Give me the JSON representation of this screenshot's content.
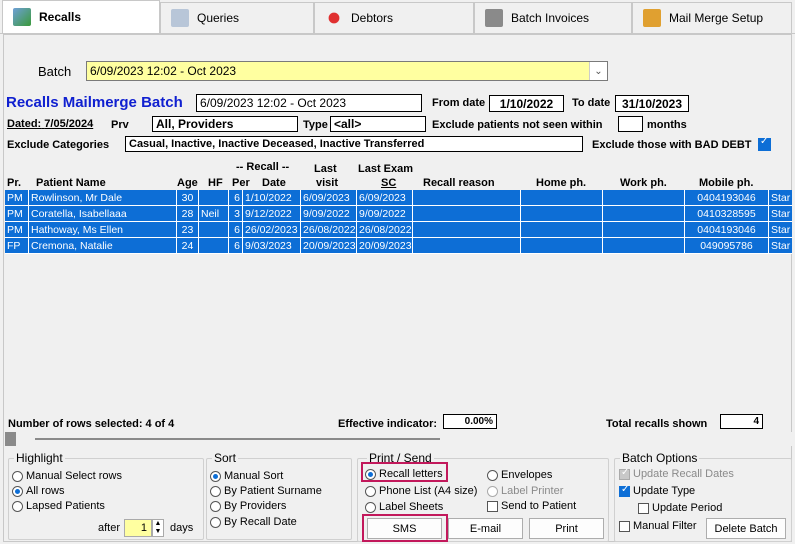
{
  "tabs": [
    {
      "label": "Recalls",
      "icon": "recalls-icon"
    },
    {
      "label": "Queries",
      "icon": "queries-icon"
    },
    {
      "label": "Debtors",
      "icon": "debtors-icon"
    },
    {
      "label": "Batch Invoices",
      "icon": "printer-icon"
    },
    {
      "label": "Mail Merge Setup",
      "icon": "mail-merge-icon"
    }
  ],
  "batch": {
    "label": "Batch",
    "value": "6/09/2023 12:02 - Oct 2023"
  },
  "header": {
    "title": "Recalls Mailmerge Batch",
    "batch_name": "6/09/2023 12:02 - Oct 2023",
    "from_label": "From date",
    "from_value": "1/10/2022",
    "to_label": "To date",
    "to_value": "31/10/2023",
    "dated_label": "Dated:",
    "dated_value": "7/05/2024",
    "prv_label": "Prv",
    "prv_value": "All,   Providers",
    "type_label": "Type",
    "type_value": "<all>",
    "exclude_not_seen_label": "Exclude patients not seen within",
    "exclude_not_seen_value": "",
    "months_label": "months",
    "exclude_categories_label": "Exclude Categories",
    "exclude_categories_value": "Casual, Inactive, Inactive Deceased, Inactive Transferred",
    "bad_debt_label": "Exclude those with BAD DEBT"
  },
  "columns": {
    "pr": "Pr.",
    "name": "Patient Name",
    "age": "Age",
    "hf": "HF",
    "recall_group": "-- Recall --",
    "per": "Per",
    "date": "Date",
    "last_visit_1": "Last",
    "last_visit_2": "visit",
    "last_exam_1": "Last Exam",
    "last_exam_2": "SC",
    "reason": "Recall reason",
    "home": "Home ph.",
    "work": "Work ph.",
    "mobile": "Mobile ph."
  },
  "rows": [
    {
      "pr": "PM",
      "name": "Rowlinson, Mr Dale",
      "age": "30",
      "hf": "",
      "per": "6",
      "date": "1/10/2022",
      "visit": "6/09/2023",
      "exam": "6/09/2023",
      "reason": "",
      "home": "",
      "work": "",
      "mobile": "0404193046",
      "extra": "Star"
    },
    {
      "pr": "PM",
      "name": "Coratella, Isabellaaa",
      "age": "28",
      "hf": "Neil",
      "per": "3",
      "date": "9/12/2022",
      "visit": "9/09/2022",
      "exam": "9/09/2022",
      "reason": "",
      "home": "",
      "work": "",
      "mobile": "0410328595",
      "extra": "Star"
    },
    {
      "pr": "PM",
      "name": "Hathoway, Ms Ellen",
      "age": "23",
      "hf": "",
      "per": "6",
      "date": "26/02/2023",
      "visit": "26/08/2022",
      "exam": "26/08/2022",
      "reason": "",
      "home": "",
      "work": "",
      "mobile": "0404193046",
      "extra": "Star"
    },
    {
      "pr": "FP",
      "name": "Cremona, Natalie",
      "age": "24",
      "hf": "",
      "per": "6",
      "date": "9/03/2023",
      "visit": "20/09/2023",
      "exam": "20/09/2023",
      "reason": "",
      "home": "",
      "work": "",
      "mobile": "049095786",
      "extra": "Star"
    }
  ],
  "footer": {
    "rows_selected": "Number of rows selected: 4 of 4",
    "effective_label": "Effective indicator:",
    "effective_value": "0.00%",
    "total_label": "Total recalls shown",
    "total_value": "4"
  },
  "highlight": {
    "title": "Highlight",
    "options": [
      "Manual Select rows",
      "All rows",
      "Lapsed Patients"
    ],
    "selected": "All rows",
    "after_label": "after",
    "after_value": "1",
    "days_label": "days"
  },
  "sort": {
    "title": "Sort",
    "options": [
      "Manual Sort",
      "By Patient Surname",
      "By Providers",
      "By Recall Date"
    ],
    "selected": "Manual Sort"
  },
  "print_send": {
    "title": "Print / Send",
    "recall_letters": "Recall letters",
    "phone_list": "Phone List (A4 size)",
    "label_sheets": "Label Sheets",
    "envelopes": "Envelopes",
    "label_printer": "Label Printer",
    "send_to_patient": "Send to Patient",
    "sms_button": "SMS",
    "email_button": "E-mail",
    "print_button": "Print"
  },
  "batch_options": {
    "title": "Batch Options",
    "update_recall_dates": "Update Recall Dates",
    "update_type": "Update Type",
    "update_period": "Update Period",
    "manual_filter": "Manual Filter",
    "delete_batch": "Delete Batch"
  },
  "colors": {
    "selection": "#0d6ed6",
    "batch_field": "#ffffa0",
    "title_blue": "#1020d0",
    "highlight_box": "#c2185b"
  }
}
